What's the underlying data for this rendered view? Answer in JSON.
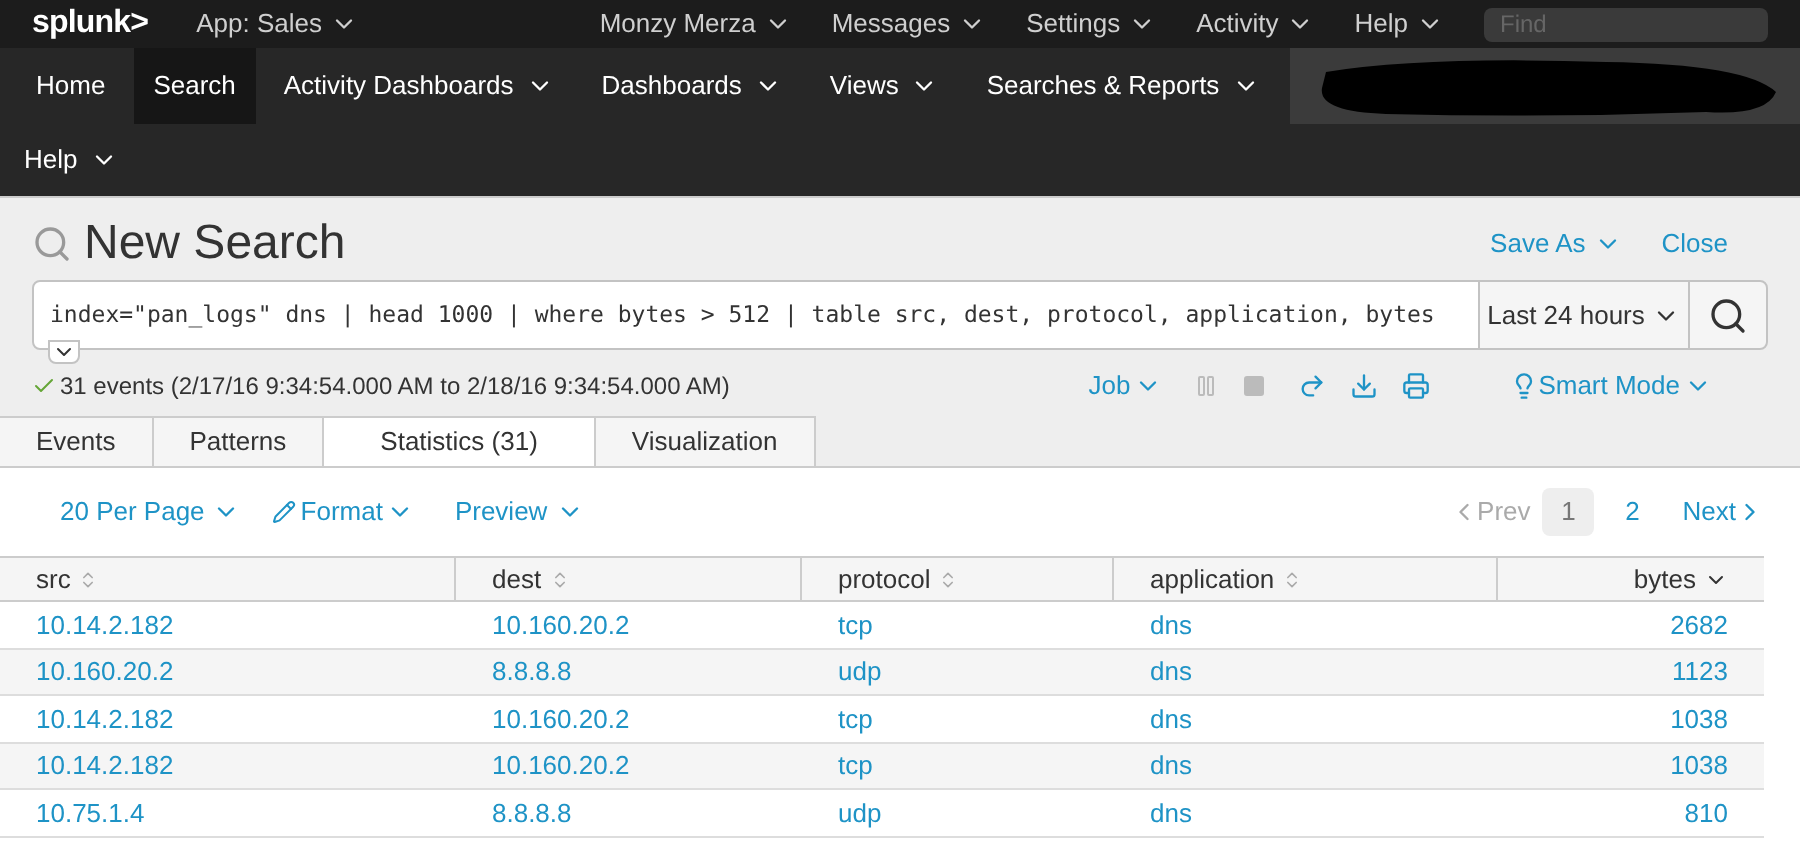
{
  "top_bar": {
    "logo": "splunk>",
    "app": "App: Sales",
    "menus": [
      "Monzy Merza",
      "Messages",
      "Settings",
      "Activity",
      "Help"
    ],
    "find": {
      "placeholder": "Find"
    }
  },
  "nav": {
    "items": [
      {
        "label": "Home",
        "selected": false,
        "dropdown": false
      },
      {
        "label": "Search",
        "selected": true,
        "dropdown": false
      },
      {
        "label": "Activity Dashboards",
        "selected": false,
        "dropdown": true
      },
      {
        "label": "Dashboards",
        "selected": false,
        "dropdown": true
      },
      {
        "label": "Views",
        "selected": false,
        "dropdown": true
      },
      {
        "label": "Searches & Reports",
        "selected": false,
        "dropdown": true
      },
      {
        "label": "Help",
        "selected": false,
        "dropdown": true
      }
    ]
  },
  "search": {
    "title": "New Search",
    "save_as": "Save As",
    "close": "Close",
    "query": "index=\"pan_logs\" dns | head 1000 | where bytes > 512 | table src, dest, protocol, application, bytes",
    "time_range": "Last 24 hours",
    "status": "31 events (2/17/16 9:34:54.000 AM to 2/18/16 9:34:54.000 AM)",
    "job": "Job",
    "mode": "Smart Mode"
  },
  "tabs": [
    {
      "label": "Events",
      "selected": false
    },
    {
      "label": "Patterns",
      "selected": false
    },
    {
      "label": "Statistics (31)",
      "selected": true
    },
    {
      "label": "Visualization",
      "selected": false
    }
  ],
  "results_toolbar": {
    "per_page": "20 Per Page",
    "format": "Format",
    "preview": "Preview",
    "prev": "Prev",
    "pages": [
      {
        "label": "1",
        "selected": true
      },
      {
        "label": "2",
        "selected": false
      }
    ],
    "next": "Next"
  },
  "table": {
    "columns": [
      {
        "label": "src",
        "sorted": false,
        "kind": "text"
      },
      {
        "label": "dest",
        "sorted": false,
        "kind": "text"
      },
      {
        "label": "protocol",
        "sorted": false,
        "kind": "text"
      },
      {
        "label": "application",
        "sorted": false,
        "kind": "text"
      },
      {
        "label": "bytes",
        "sorted": true,
        "kind": "number"
      }
    ],
    "rows": [
      [
        "10.14.2.182",
        "10.160.20.2",
        "tcp",
        "dns",
        "2682"
      ],
      [
        "10.160.20.2",
        "8.8.8.8",
        "udp",
        "dns",
        "1123"
      ],
      [
        "10.14.2.182",
        "10.160.20.2",
        "tcp",
        "dns",
        "1038"
      ],
      [
        "10.14.2.182",
        "10.160.20.2",
        "tcp",
        "dns",
        "1038"
      ],
      [
        "10.75.1.4",
        "8.8.8.8",
        "udp",
        "dns",
        "810"
      ]
    ]
  }
}
